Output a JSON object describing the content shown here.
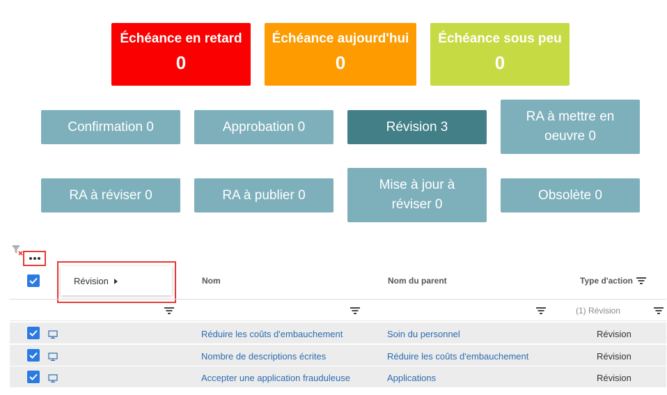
{
  "due": {
    "late": {
      "title": "Échéance en retard",
      "count": "0",
      "color": "#fb0000"
    },
    "today": {
      "title": "Échéance aujourd'hui",
      "count": "0",
      "color": "#fd9b00"
    },
    "soon": {
      "title": "Échéance sous peu",
      "count": "0",
      "color": "#c6da43"
    }
  },
  "status_tiles": {
    "confirmation": "Confirmation 0",
    "approbation": "Approbation 0",
    "revision": "Révision 3",
    "ra_mettre_en_oeuvre": "RA à mettre en oeuvre 0",
    "ra_reviser": "RA à réviser 0",
    "ra_publier": "RA à publier 0",
    "mise_a_jour": "Mise à jour à réviser 0",
    "obsolete": "Obsolète 0",
    "active": "revision",
    "colors": {
      "tile": "#7db0bb",
      "active": "#427f87"
    }
  },
  "grid": {
    "group_menu_label": "Révision",
    "headers": {
      "nom": "Nom",
      "nom_parent": "Nom du parent",
      "type_action": "Type d'action"
    },
    "type_action_filter": "(1) Révision",
    "rows": [
      {
        "name": "Réduire les coûts d'embauchement",
        "parent": "Soin du personnel",
        "action": "Révision",
        "checked": true,
        "icon": "monitor-icon"
      },
      {
        "name": "Nombre de descriptions écrites",
        "parent": "Réduire les coûts d'embauchement",
        "action": "Révision",
        "checked": true,
        "icon": "monitor-icon"
      },
      {
        "name": "Accepter une application frauduleuse",
        "parent": "Applications",
        "action": "Révision",
        "checked": true,
        "icon": "monitor-icon"
      }
    ]
  }
}
